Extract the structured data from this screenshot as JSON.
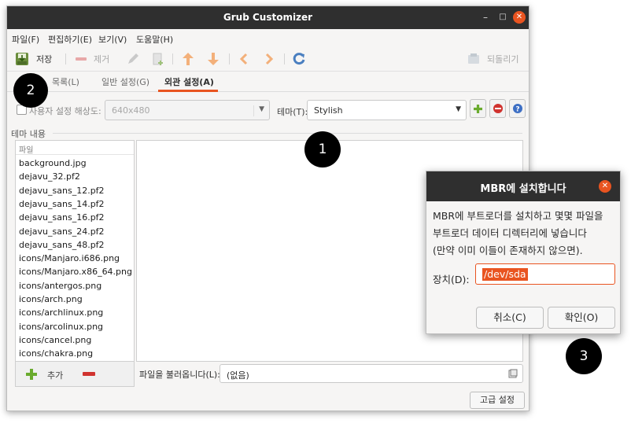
{
  "window": {
    "title": "Grub Customizer",
    "minimize_glyph": "–",
    "maximize_glyph": "□",
    "close_glyph": "✕"
  },
  "menu": [
    "파일(F)",
    "편집하기(E)",
    "보기(V)",
    "도움말(H)"
  ],
  "toolbar": {
    "save_label": "저장",
    "remove_label": "제거",
    "revert_label": "되돌리기",
    "icons": [
      "save-icon",
      "remove-icon",
      "edit-icon",
      "new-file-icon",
      "up-arrow-icon",
      "down-arrow-icon",
      "left-arrow-icon",
      "right-arrow-icon",
      "refresh-icon",
      "revert-icon"
    ]
  },
  "tabs": [
    {
      "label": "목록(L)",
      "active": false
    },
    {
      "label": "일반 설정(G)",
      "active": false
    },
    {
      "label": "외관 설정(A)",
      "active": true
    }
  ],
  "appearance": {
    "custom_resolution_label": "사용자 설정 해상도:",
    "resolution_value": "640x480",
    "theme_label": "테마(T):",
    "theme_value": "Stylish",
    "theme_contents_label": "테마 내용",
    "files_header": "파일",
    "files": [
      "background.jpg",
      "dejavu_32.pf2",
      "dejavu_sans_12.pf2",
      "dejavu_sans_14.pf2",
      "dejavu_sans_16.pf2",
      "dejavu_sans_24.pf2",
      "dejavu_sans_48.pf2",
      "icons/Manjaro.i686.png",
      "icons/Manjaro.x86_64.png",
      "icons/antergos.png",
      "icons/arch.png",
      "icons/archlinux.png",
      "icons/arcolinux.png",
      "icons/cancel.png",
      "icons/chakra.png"
    ],
    "add_label": "추가",
    "load_file_label": "파일을 불러옵니다(L):",
    "load_file_value": "(없음)",
    "advanced_button": "고급 설정"
  },
  "callouts": [
    "1",
    "2",
    "3"
  ],
  "dialog": {
    "title": "MBR에 설치합니다",
    "message_lines": [
      "MBR에 부트로더를 설치하고 몇몇 파일을",
      "부트로더 데이터 디렉터리에 넣습니다",
      "(만약 이미 이들이 존재하지 않으면)."
    ],
    "device_label": "장치(D):",
    "device_value": "/dev/sda",
    "cancel_button": "취소(C)",
    "ok_button": "확인(O)"
  },
  "colors": {
    "accent": "#e95420",
    "titlebar": "#2f2f2f",
    "window_bg": "#f6f5f4"
  }
}
